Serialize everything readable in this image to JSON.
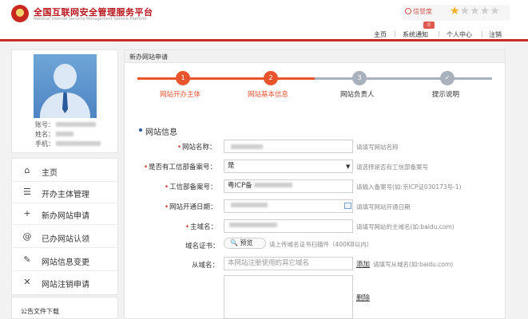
{
  "header": {
    "title": "全国互联网安全管理服务平台",
    "subtitle": "National Internet Security Management Service Platform",
    "credit_label": "信誉度",
    "rating": 1,
    "rating_max": 5,
    "badge": "0",
    "nav": [
      "主页",
      "系统通知",
      "个人中心",
      "注销"
    ]
  },
  "profile": {
    "account_label": "账号：",
    "name_label": "姓名：",
    "phone_label": "手机："
  },
  "sidebar": {
    "items": [
      {
        "icon": "home-icon",
        "glyph": "⌂",
        "label": "主页"
      },
      {
        "icon": "list-icon",
        "glyph": "☰",
        "label": "开办主体管理"
      },
      {
        "icon": "plus-icon",
        "glyph": "+",
        "label": "新办网站申请"
      },
      {
        "icon": "at-icon",
        "glyph": "@",
        "label": "已办网站认领"
      },
      {
        "icon": "edit-icon",
        "glyph": "✎",
        "label": "网站信息变更"
      },
      {
        "icon": "close-icon",
        "glyph": "✕",
        "label": "网站注销申请"
      }
    ],
    "notice_title": "公告文件下载"
  },
  "main": {
    "panel_title": "新办网站申请",
    "steps": [
      {
        "num": "1",
        "label": "网站开办主体",
        "state": "done"
      },
      {
        "num": "2",
        "label": "网站基本信息",
        "state": "active"
      },
      {
        "num": "3",
        "label": "网站负责人",
        "state": "todo"
      },
      {
        "num": "✓",
        "label": "提示说明",
        "state": "todo"
      }
    ],
    "section_title": "网站信息",
    "colors": {
      "active": "#e8542c",
      "inactive": "#a9b1bd",
      "required": "#d9302a"
    },
    "fields": {
      "site_name": {
        "label": "网站名称：",
        "required": true,
        "hint": "请填写网站名称"
      },
      "icp_filed": {
        "label": "是否有工信部备案号：",
        "required": true,
        "value": "是",
        "hint": "请选择是否有工信部备案号"
      },
      "icp_number": {
        "label": "工信部备案号：",
        "required": true,
        "value": "粤ICP备",
        "hint": "请输入备案号(如:京ICP证030173号-1)"
      },
      "open_date": {
        "label": "网站开通日期：",
        "required": true,
        "hint": "请填写网站开通日期"
      },
      "domain": {
        "label": "主域名：",
        "required": true,
        "hint": "请填写网站的主域名(如:baidu.com)"
      },
      "cert": {
        "label": "域名证书：",
        "required": false,
        "button": "预览",
        "hint": "请上传域名证书扫描件（400KB以内）"
      },
      "sub_domain": {
        "label": "从域名：",
        "required": false,
        "placeholder": "本网站注册使用的其它域名",
        "add": "添加",
        "hint": "请填写从域名(如:baidu.com)",
        "delete": "删除"
      }
    }
  }
}
